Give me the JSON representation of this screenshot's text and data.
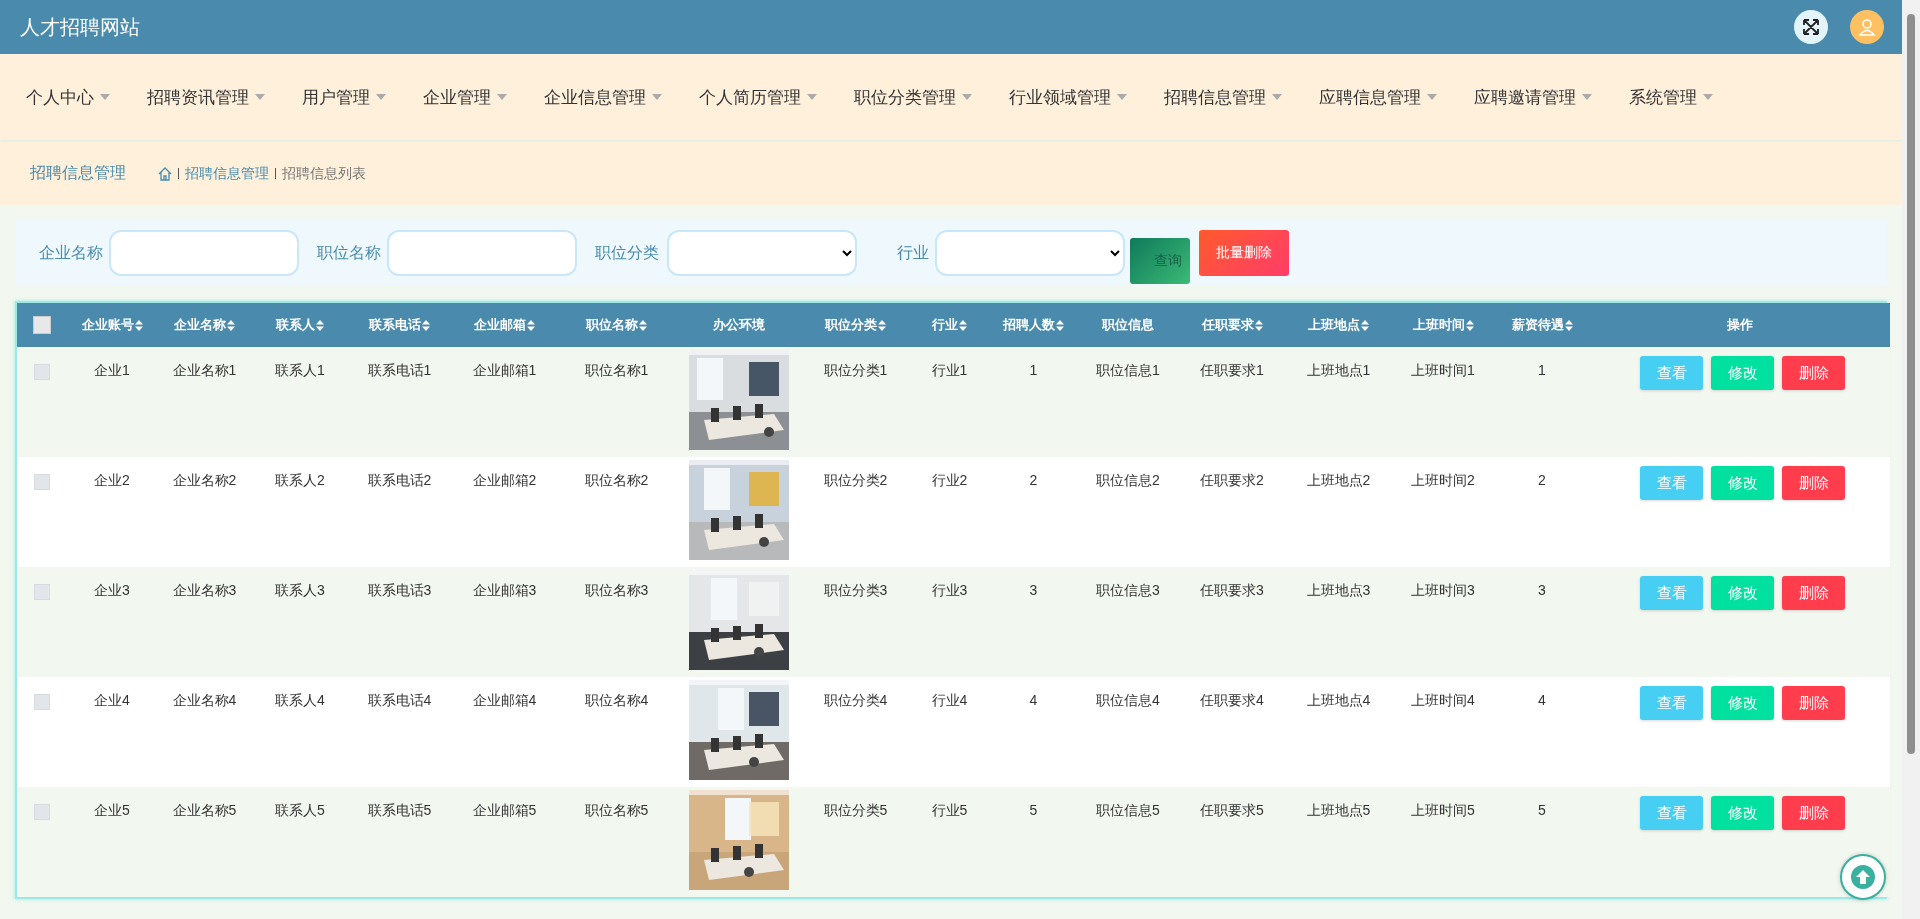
{
  "header": {
    "title": "人才招聘网站"
  },
  "nav": [
    {
      "label": "个人中心"
    },
    {
      "label": "招聘资讯管理"
    },
    {
      "label": "用户管理"
    },
    {
      "label": "企业管理"
    },
    {
      "label": "企业信息管理"
    },
    {
      "label": "个人简历管理"
    },
    {
      "label": "职位分类管理"
    },
    {
      "label": "行业领域管理"
    },
    {
      "label": "招聘信息管理"
    },
    {
      "label": "应聘信息管理"
    },
    {
      "label": "应聘邀请管理"
    },
    {
      "label": "系统管理"
    }
  ],
  "breadcrumb": {
    "title": "招聘信息管理",
    "path": [
      "招聘信息管理",
      "招聘信息列表"
    ]
  },
  "search": {
    "fields": [
      {
        "kind": "input",
        "label": "企业名称"
      },
      {
        "kind": "input",
        "label": "职位名称"
      },
      {
        "kind": "select",
        "label": "职位分类"
      },
      {
        "kind": "select",
        "label": "行业"
      }
    ],
    "buttons": [
      {
        "kind": "search",
        "label": "查询"
      },
      {
        "kind": "delete",
        "label": "批量删除"
      }
    ]
  },
  "table": {
    "select_all": {
      "checked": false
    },
    "columns": [
      {
        "label": "企业账号",
        "sortable": true
      },
      {
        "label": "企业名称",
        "sortable": true
      },
      {
        "label": "联系人",
        "sortable": true
      },
      {
        "label": "联系电话",
        "sortable": true
      },
      {
        "label": "企业邮箱",
        "sortable": true
      },
      {
        "label": "职位名称",
        "sortable": true
      },
      {
        "label": "办公环境",
        "sortable": false
      },
      {
        "label": "职位分类",
        "sortable": true
      },
      {
        "label": "行业",
        "sortable": true
      },
      {
        "label": "招聘人数",
        "sortable": true
      },
      {
        "label": "职位信息",
        "sortable": false
      },
      {
        "label": "任职要求",
        "sortable": true
      },
      {
        "label": "上班地点",
        "sortable": true
      },
      {
        "label": "上班时间",
        "sortable": true
      },
      {
        "label": "薪资待遇",
        "sortable": true
      },
      {
        "label": "操作",
        "sortable": false
      }
    ],
    "rows": [
      {
        "checked": false,
        "cells": [
          "企业1",
          "企业名称1",
          "联系人1",
          "联系电话1",
          "企业邮箱1",
          "职位名称1",
          {
            "kind": "picture"
          },
          "职位分类1",
          "行业1",
          "1",
          "职位信息1",
          "任职要求1",
          "上班地点1",
          "上班时间1",
          "1"
        ],
        "actions": [
          {
            "kind": "view",
            "label": "查看"
          },
          {
            "kind": "edit",
            "label": "修改"
          },
          {
            "kind": "delete",
            "label": "删除"
          }
        ]
      },
      {
        "checked": false,
        "cells": [
          "企业2",
          "企业名称2",
          "联系人2",
          "联系电话2",
          "企业邮箱2",
          "职位名称2",
          {
            "kind": "picture"
          },
          "职位分类2",
          "行业2",
          "2",
          "职位信息2",
          "任职要求2",
          "上班地点2",
          "上班时间2",
          "2"
        ],
        "actions": [
          {
            "kind": "view",
            "label": "查看"
          },
          {
            "kind": "edit",
            "label": "修改"
          },
          {
            "kind": "delete",
            "label": "删除"
          }
        ]
      },
      {
        "checked": false,
        "cells": [
          "企业3",
          "企业名称3",
          "联系人3",
          "联系电话3",
          "企业邮箱3",
          "职位名称3",
          {
            "kind": "picture"
          },
          "职位分类3",
          "行业3",
          "3",
          "职位信息3",
          "任职要求3",
          "上班地点3",
          "上班时间3",
          "3"
        ],
        "actions": [
          {
            "kind": "view",
            "label": "查看"
          },
          {
            "kind": "edit",
            "label": "修改"
          },
          {
            "kind": "delete",
            "label": "删除"
          }
        ]
      },
      {
        "checked": false,
        "cells": [
          "企业4",
          "企业名称4",
          "联系人4",
          "联系电话4",
          "企业邮箱4",
          "职位名称4",
          {
            "kind": "picture"
          },
          "职位分类4",
          "行业4",
          "4",
          "职位信息4",
          "任职要求4",
          "上班地点4",
          "上班时间4",
          "4"
        ],
        "actions": [
          {
            "kind": "view",
            "label": "查看"
          },
          {
            "kind": "edit",
            "label": "修改"
          },
          {
            "kind": "delete",
            "label": "删除"
          }
        ]
      },
      {
        "checked": false,
        "cells": [
          "企业5",
          "企业名称5",
          "联系人5",
          "联系电话5",
          "企业邮箱5",
          "职位名称5",
          {
            "kind": "picture"
          },
          "职位分类5",
          "行业5",
          "5",
          "职位信息5",
          "任职要求5",
          "上班地点5",
          "上班时间5",
          "5"
        ],
        "actions": [
          {
            "kind": "view",
            "label": "查看"
          },
          {
            "kind": "edit",
            "label": "修改"
          },
          {
            "kind": "delete",
            "label": "删除"
          }
        ]
      }
    ]
  }
}
